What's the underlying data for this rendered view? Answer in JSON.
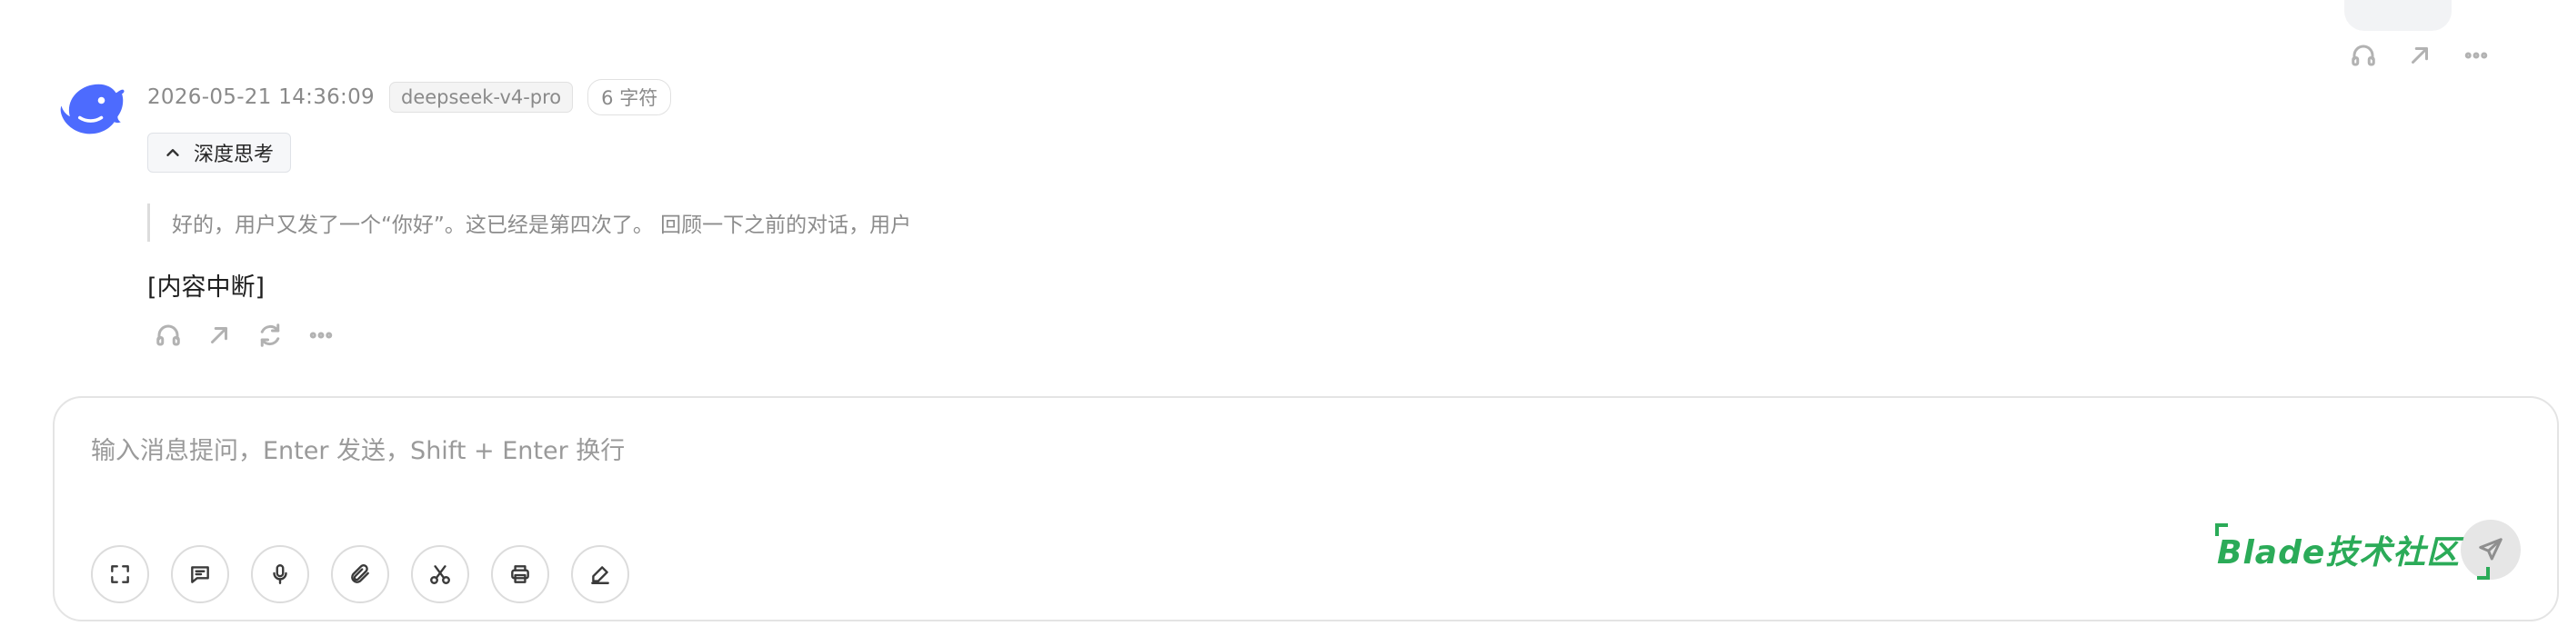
{
  "previous_message": {
    "actions": [
      "headphones-icon",
      "share-arrow-icon",
      "more-icon"
    ]
  },
  "assistant_message": {
    "avatar": "deepseek-whale-logo",
    "timestamp": "2026-05-21 14:36:09",
    "model_tag": "deepseek-v4-pro",
    "char_count": "6 字符",
    "think_toggle_label": "深度思考",
    "reasoning_text": "好的，用户又发了一个“你好”。这已经是第四次了。 回顾一下之前的对话，用户",
    "answer_text": "[内容中断]",
    "actions": [
      "headphones-icon",
      "share-arrow-icon",
      "regenerate-icon",
      "more-icon"
    ]
  },
  "composer": {
    "placeholder": "输入消息提问，Enter 发送，Shift + Enter 换行",
    "value": "",
    "tools": [
      "fullscreen-icon",
      "message-icon",
      "microphone-icon",
      "attachment-icon",
      "scissors-icon",
      "print-icon",
      "pen-icon"
    ],
    "send_icon": "send-icon"
  },
  "watermark": {
    "text": "Blade技术社区"
  },
  "colors": {
    "accent_blue": "#4d6bfe",
    "watermark_green": "#2bab58",
    "muted_text": "#8a8a8a"
  }
}
